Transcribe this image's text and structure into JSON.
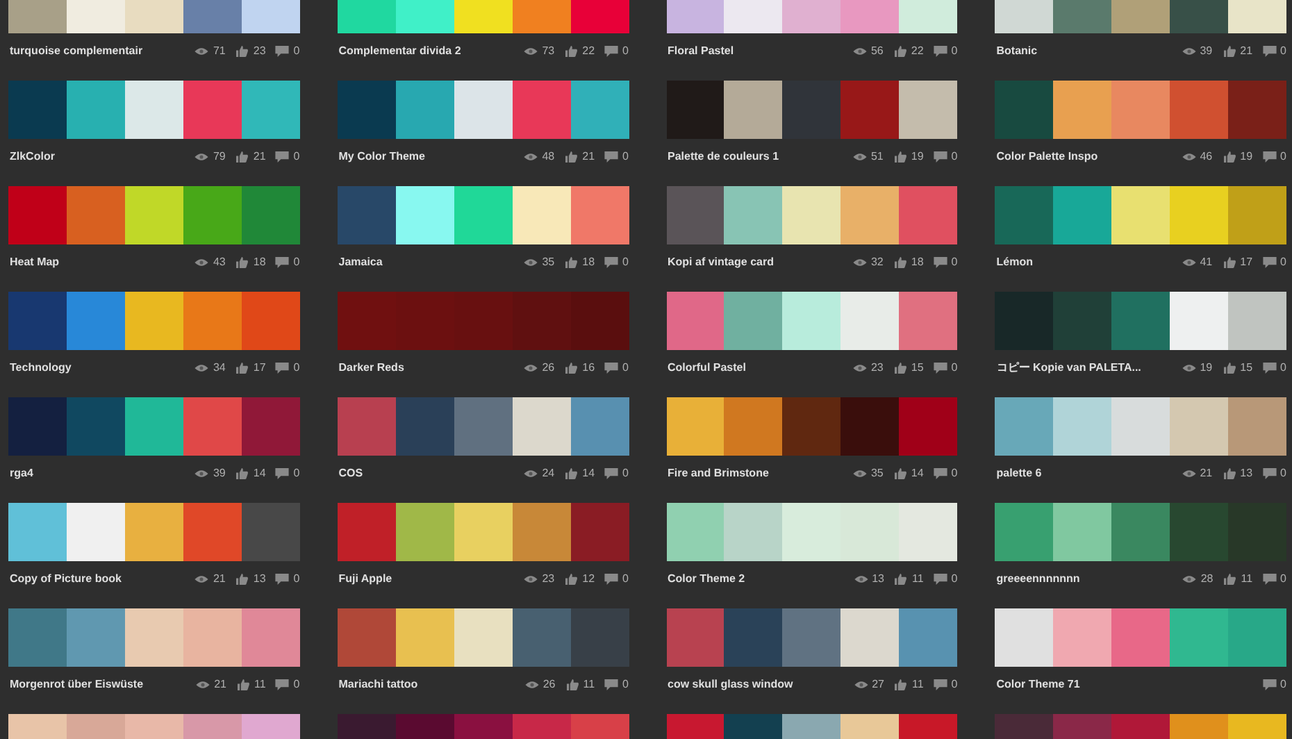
{
  "palettes": [
    {
      "title": "turquoise complementair",
      "views": "71",
      "likes": "23",
      "comments": "0",
      "swatches": [
        {
          "color": "#a8a088"
        },
        {
          "color": "#f0ece0"
        },
        {
          "color": "#e8dcc0"
        },
        {
          "color": "#6880a8"
        },
        {
          "color": "#c0d4f0"
        }
      ]
    },
    {
      "title": "Complementar divida 2",
      "views": "73",
      "likes": "22",
      "comments": "0",
      "swatches": [
        {
          "color": "#20d8a0"
        },
        {
          "color": "#40f0c8"
        },
        {
          "color": "#f0e020"
        },
        {
          "color": "#f08020"
        },
        {
          "color": "#e80038"
        }
      ]
    },
    {
      "title": "Floral Pastel",
      "views": "56",
      "likes": "22",
      "comments": "0",
      "swatches": [
        {
          "color": "#c8b4e0"
        },
        {
          "color": "#ece8f0"
        },
        {
          "color": "#e0b0d0"
        },
        {
          "color": "#e898c0"
        },
        {
          "color": "#d0ecdc"
        }
      ]
    },
    {
      "title": "Botanic",
      "views": "39",
      "likes": "21",
      "comments": "0",
      "swatches": [
        {
          "color": "#d0d8d4"
        },
        {
          "color": "#5a7a6c"
        },
        {
          "color": "#b0a078"
        },
        {
          "color": "#385048"
        },
        {
          "color": "#e8e4c8"
        }
      ]
    },
    {
      "title": "ZlkColor",
      "views": "79",
      "likes": "21",
      "comments": "0",
      "swatches": [
        {
          "color": "#0a3a50"
        },
        {
          "color": "#28b0b0"
        },
        {
          "color": "#dce8e8"
        },
        {
          "color": "#e83858"
        },
        {
          "color": "#30b8b8"
        }
      ]
    },
    {
      "title": "My Color Theme",
      "views": "48",
      "likes": "21",
      "comments": "0",
      "swatches": [
        {
          "color": "#0a3a50"
        },
        {
          "color": "#28a8b0"
        },
        {
          "color": "#dce4e8"
        },
        {
          "color": "#e83858"
        },
        {
          "color": "#30b0b8"
        }
      ]
    },
    {
      "title": "Palette de couleurs 1",
      "views": "51",
      "likes": "19",
      "comments": "0",
      "swatches": [
        {
          "color": "#201a18"
        },
        {
          "color": "#b4aa98"
        },
        {
          "color": "#30343a"
        },
        {
          "color": "#981818"
        },
        {
          "color": "#c4bcac"
        }
      ]
    },
    {
      "title": "Color Palette Inspo",
      "views": "46",
      "likes": "19",
      "comments": "0",
      "swatches": [
        {
          "color": "#184a40"
        },
        {
          "color": "#e8a050"
        },
        {
          "color": "#e88860"
        },
        {
          "color": "#d05030"
        },
        {
          "color": "#7a2018"
        }
      ]
    },
    {
      "title": "Heat Map",
      "views": "43",
      "likes": "18",
      "comments": "0",
      "swatches": [
        {
          "color": "#c00018"
        },
        {
          "color": "#d86020"
        },
        {
          "color": "#c0d828"
        },
        {
          "color": "#48a818"
        },
        {
          "color": "#208838"
        }
      ]
    },
    {
      "title": "Jamaica",
      "views": "35",
      "likes": "18",
      "comments": "0",
      "swatches": [
        {
          "color": "#284868"
        },
        {
          "color": "#88f8f0"
        },
        {
          "color": "#20d898"
        },
        {
          "color": "#f8e8b8"
        },
        {
          "color": "#f07868"
        }
      ]
    },
    {
      "title": "Kopi af vintage card",
      "views": "32",
      "likes": "18",
      "comments": "0",
      "swatches": [
        {
          "color": "#5a5458"
        },
        {
          "color": "#88c4b4"
        },
        {
          "color": "#e8e4b0"
        },
        {
          "color": "#e8b068"
        },
        {
          "color": "#e05060"
        }
      ]
    },
    {
      "title": "Lémon",
      "views": "41",
      "likes": "17",
      "comments": "0",
      "swatches": [
        {
          "color": "#186858"
        },
        {
          "color": "#18a898"
        },
        {
          "color": "#e8e070"
        },
        {
          "color": "#e8d020"
        },
        {
          "color": "#c0a018"
        }
      ]
    },
    {
      "title": "Technology",
      "views": "34",
      "likes": "17",
      "comments": "0",
      "swatches": [
        {
          "color": "#183870"
        },
        {
          "color": "#2888d8"
        },
        {
          "color": "#e8b820"
        },
        {
          "color": "#e87818"
        },
        {
          "color": "#e04818"
        }
      ]
    },
    {
      "title": "Darker Reds",
      "views": "26",
      "likes": "16",
      "comments": "0",
      "swatches": [
        {
          "color": "#701010"
        },
        {
          "color": "#6c1010"
        },
        {
          "color": "#681010"
        },
        {
          "color": "#601010"
        },
        {
          "color": "#5a0e0e"
        }
      ]
    },
    {
      "title": "Colorful Pastel",
      "views": "23",
      "likes": "15",
      "comments": "0",
      "swatches": [
        {
          "color": "#e06888"
        },
        {
          "color": "#70b0a0"
        },
        {
          "color": "#b8ecdc"
        },
        {
          "color": "#e8ece8"
        },
        {
          "color": "#e07080"
        }
      ]
    },
    {
      "title": "コピー Kopie van PALETA...",
      "views": "19",
      "likes": "15",
      "comments": "0",
      "swatches": [
        {
          "color": "#182828"
        },
        {
          "color": "#204038"
        },
        {
          "color": "#207060"
        },
        {
          "color": "#eef0f0"
        },
        {
          "color": "#c0c4c0"
        }
      ]
    },
    {
      "title": "rga4",
      "views": "39",
      "likes": "14",
      "comments": "0",
      "swatches": [
        {
          "color": "#142040"
        },
        {
          "color": "#104860"
        },
        {
          "color": "#20b898"
        },
        {
          "color": "#e04848"
        },
        {
          "color": "#901838"
        }
      ]
    },
    {
      "title": "COS",
      "views": "24",
      "likes": "14",
      "comments": "0",
      "swatches": [
        {
          "color": "#b84050"
        },
        {
          "color": "#2a4058"
        },
        {
          "color": "#607080"
        },
        {
          "color": "#dcd8cc"
        },
        {
          "color": "#5890b0"
        }
      ]
    },
    {
      "title": "Fire and Brimstone",
      "views": "35",
      "likes": "14",
      "comments": "0",
      "swatches": [
        {
          "color": "#e8b038"
        },
        {
          "color": "#d07820"
        },
        {
          "color": "#602810"
        },
        {
          "color": "#3a0e0c"
        },
        {
          "color": "#a00018"
        }
      ]
    },
    {
      "title": "palette 6",
      "views": "21",
      "likes": "13",
      "comments": "0",
      "swatches": [
        {
          "color": "#68a8b8"
        },
        {
          "color": "#b0d4d8"
        },
        {
          "color": "#d8dcdc"
        },
        {
          "color": "#d4c8b0"
        },
        {
          "color": "#b89878"
        }
      ]
    },
    {
      "title": "Copy of Picture book",
      "views": "21",
      "likes": "13",
      "comments": "0",
      "swatches": [
        {
          "color": "#60c0d8"
        },
        {
          "color": "#f0f0f0"
        },
        {
          "color": "#e8b040"
        },
        {
          "color": "#e04828"
        },
        {
          "color": "#484848"
        }
      ]
    },
    {
      "title": "Fuji Apple",
      "views": "23",
      "likes": "12",
      "comments": "0",
      "swatches": [
        {
          "color": "#c02028"
        },
        {
          "color": "#a0b848"
        },
        {
          "color": "#e8d060"
        },
        {
          "color": "#c88838"
        },
        {
          "color": "#8a1c24"
        }
      ]
    },
    {
      "title": "Color Theme 2",
      "views": "13",
      "likes": "11",
      "comments": "0",
      "swatches": [
        {
          "color": "#90d0b0"
        },
        {
          "color": "#b8d4c8"
        },
        {
          "color": "#d8ecdc"
        },
        {
          "color": "#d8e8d8"
        },
        {
          "color": "#e4e8e0"
        }
      ]
    },
    {
      "title": "greeeennnnnnn",
      "views": "28",
      "likes": "11",
      "comments": "0",
      "swatches": [
        {
          "color": "#38a070"
        },
        {
          "color": "#80c8a0"
        },
        {
          "color": "#3a8860"
        },
        {
          "color": "#284830"
        },
        {
          "color": "#283828"
        }
      ]
    },
    {
      "title": "Morgenrot über Eiswüste",
      "views": "21",
      "likes": "11",
      "comments": "0",
      "swatches": [
        {
          "color": "#407888"
        },
        {
          "color": "#6098b0"
        },
        {
          "color": "#e8cab0"
        },
        {
          "color": "#e8b4a0"
        },
        {
          "color": "#e08898"
        }
      ]
    },
    {
      "title": "Mariachi tattoo",
      "views": "26",
      "likes": "11",
      "comments": "0",
      "swatches": [
        {
          "color": "#b04838"
        },
        {
          "color": "#e8c050"
        },
        {
          "color": "#e8e0c0"
        },
        {
          "color": "#486070"
        },
        {
          "color": "#384048"
        }
      ]
    },
    {
      "title": "cow skull glass window",
      "views": "27",
      "likes": "11",
      "comments": "0",
      "swatches": [
        {
          "color": "#b84250"
        },
        {
          "color": "#2a4258"
        },
        {
          "color": "#607282"
        },
        {
          "color": "#dcd8ce"
        },
        {
          "color": "#5892b0"
        }
      ]
    },
    {
      "title": "Color Theme 71",
      "comments": "0",
      "swatches": [
        {
          "color": "#e0e0e0"
        },
        {
          "color": "#f0a8b0"
        },
        {
          "color": "#e86888"
        },
        {
          "color": "#30b890"
        },
        {
          "color": "#28a888"
        }
      ]
    },
    {
      "swatches": [
        {
          "color": "#e8c4a8"
        },
        {
          "color": "#d8a898"
        },
        {
          "color": "#e8b8a8"
        },
        {
          "color": "#d898a8"
        },
        {
          "color": "#e0a8d0"
        }
      ]
    },
    {
      "swatches": [
        {
          "color": "#3a1a30"
        },
        {
          "color": "#5a0a30"
        },
        {
          "color": "#8a1040"
        },
        {
          "color": "#c82848"
        },
        {
          "color": "#d84048"
        }
      ]
    },
    {
      "swatches": [
        {
          "color": "#c81830"
        },
        {
          "color": "#134050"
        },
        {
          "color": "#8aa8b0"
        },
        {
          "color": "#e8c898"
        },
        {
          "color": "#c81828"
        }
      ]
    },
    {
      "swatches": [
        {
          "color": "#4a2a38"
        },
        {
          "color": "#8a2848"
        },
        {
          "color": "#b01838"
        },
        {
          "color": "#e0901c"
        },
        {
          "color": "#e8b820"
        }
      ]
    }
  ]
}
